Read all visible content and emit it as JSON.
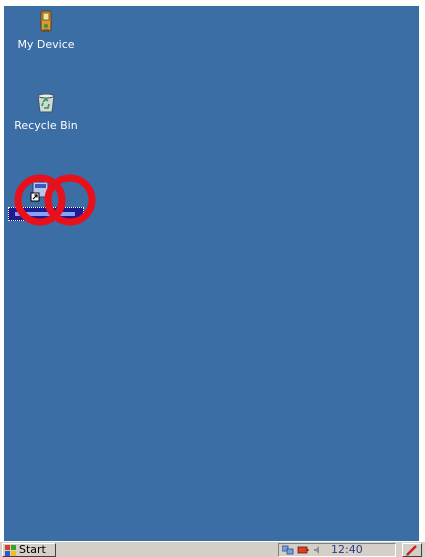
{
  "desktop": {
    "background_color": "#3a6ea5",
    "icons": [
      {
        "label": "My Device",
        "icon": "handheld-device-icon"
      },
      {
        "label": "Recycle Bin",
        "icon": "recycle-bin-icon"
      },
      {
        "label": "",
        "icon": "shortcut-app-icon"
      }
    ],
    "annotation_color": "#e8101a"
  },
  "taskbar": {
    "start_label": "Start",
    "start_icon": "windows-flag-icon",
    "tray": {
      "icons": [
        "network-icon",
        "battery-icon",
        "speaker-icon"
      ],
      "clock": "12:40"
    },
    "desktop_icon": "show-desktop-icon",
    "input_icon": "pen-input-icon"
  }
}
